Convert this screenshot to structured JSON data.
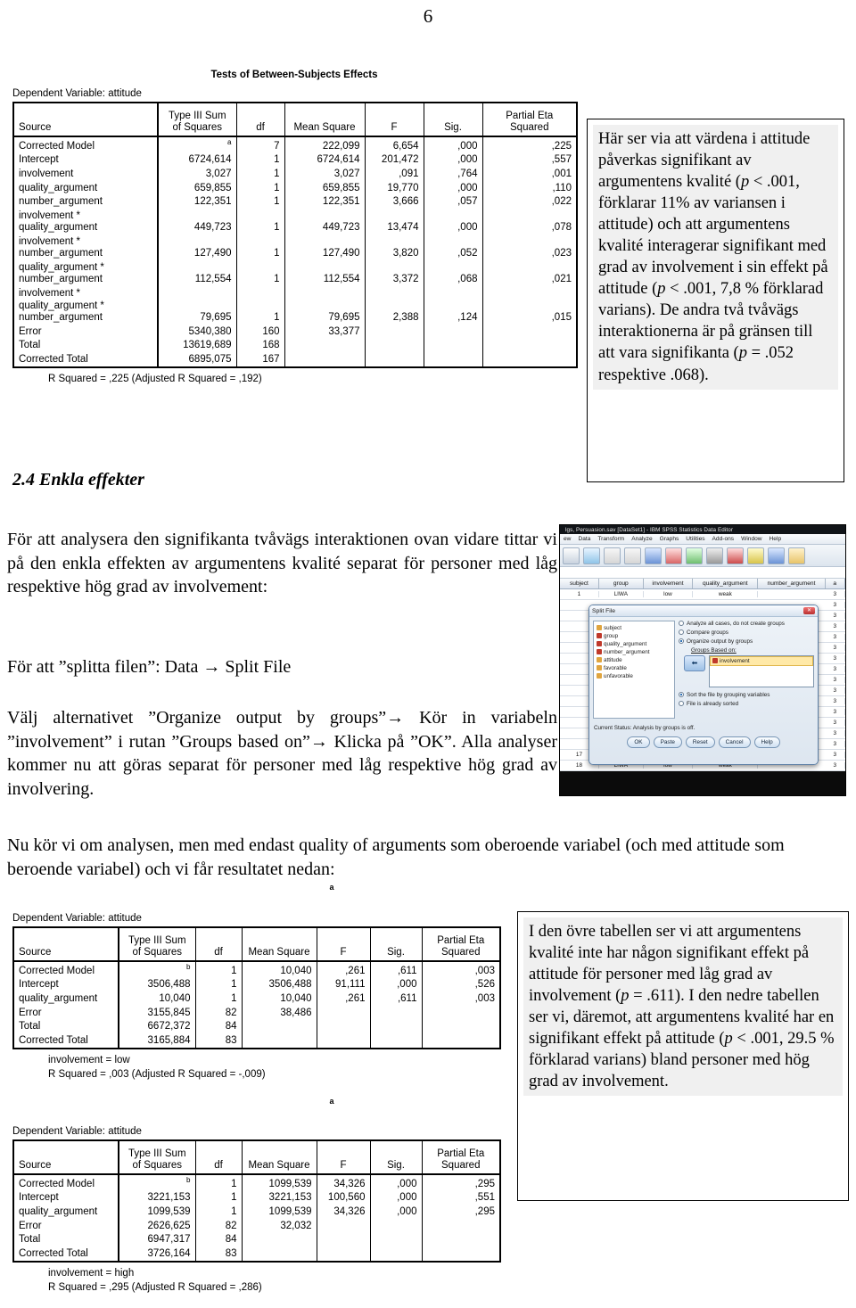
{
  "page": {
    "number": "6"
  },
  "table1": {
    "title": "Tests of Between-Subjects Effects",
    "dependent_variable": "Dependent Variable: attitude",
    "columns": [
      "Source",
      "Type III Sum\nof Squares",
      "df",
      "Mean Square",
      "F",
      "Sig.",
      "Partial Eta\nSquared"
    ],
    "col_source": "Source",
    "col_ss_l1": "Type III Sum",
    "col_ss_l2": "of Squares",
    "col_df": "df",
    "col_ms": "Mean Square",
    "col_f": "F",
    "col_sig": "Sig.",
    "col_eta_l1": "Partial Eta",
    "col_eta_l2": "Squared",
    "rows": [
      {
        "source": "Corrected Model",
        "ss": "",
        "ss_sup": "a",
        "df": "7",
        "ms": "222,099",
        "f": "6,654",
        "sig": ",000",
        "eta": ",225"
      },
      {
        "source": "Intercept",
        "ss": "6724,614",
        "ss_sup": "",
        "df": "1",
        "ms": "6724,614",
        "f": "201,472",
        "sig": ",000",
        "eta": ",557"
      },
      {
        "source": "involvement",
        "ss": "3,027",
        "ss_sup": "",
        "df": "1",
        "ms": "3,027",
        "f": ",091",
        "sig": ",764",
        "eta": ",001"
      },
      {
        "source": "quality_argument",
        "ss": "659,855",
        "ss_sup": "",
        "df": "1",
        "ms": "659,855",
        "f": "19,770",
        "sig": ",000",
        "eta": ",110"
      },
      {
        "source": "number_argument",
        "ss": "122,351",
        "ss_sup": "",
        "df": "1",
        "ms": "122,351",
        "f": "3,666",
        "sig": ",057",
        "eta": ",022"
      },
      {
        "source": "involvement *\nquality_argument",
        "ss": "449,723",
        "ss_sup": "",
        "df": "1",
        "ms": "449,723",
        "f": "13,474",
        "sig": ",000",
        "eta": ",078"
      },
      {
        "source": "involvement *\nnumber_argument",
        "ss": "127,490",
        "ss_sup": "",
        "df": "1",
        "ms": "127,490",
        "f": "3,820",
        "sig": ",052",
        "eta": ",023"
      },
      {
        "source": "quality_argument *\nnumber_argument",
        "ss": "112,554",
        "ss_sup": "",
        "df": "1",
        "ms": "112,554",
        "f": "3,372",
        "sig": ",068",
        "eta": ",021"
      },
      {
        "source": "involvement *\nquality_argument *\nnumber_argument",
        "ss": "79,695",
        "ss_sup": "",
        "df": "1",
        "ms": "79,695",
        "f": "2,388",
        "sig": ",124",
        "eta": ",015"
      },
      {
        "source": "Error",
        "ss": "5340,380",
        "ss_sup": "",
        "df": "160",
        "ms": "33,377",
        "f": "",
        "sig": "",
        "eta": ""
      },
      {
        "source": "Total",
        "ss": "13619,689",
        "ss_sup": "",
        "df": "168",
        "ms": "",
        "f": "",
        "sig": "",
        "eta": ""
      },
      {
        "source": "Corrected Total",
        "ss": "6895,075",
        "ss_sup": "",
        "df": "167",
        "ms": "",
        "f": "",
        "sig": "",
        "eta": ""
      }
    ],
    "footnote": "R Squared = ,225 (Adjusted R Squared = ,192)"
  },
  "callout1": {
    "line1": "Här ser via att värdena i attitude påverkas signifikant av argumentens kvalité (",
    "it1": "p",
    "line2": " < .001, förklarar 11% av variansen i attitude) och att argumentens kvalité interagerar signifikant med grad av involvement i sin effekt på attitude (",
    "it2": "p",
    "line3": " < .001, 7,8 % förklarad varians). De andra två tvåvägs interaktionerna är på gränsen till att vara signifikanta (",
    "it3": "p",
    "line4": " = .052 respektive .068)."
  },
  "section": {
    "heading": "2.4 Enkla effekter",
    "para1": "För att analysera den signifikanta tvåvägs interaktionen ovan vidare tittar vi på den enkla effekten av argumentens kvalité separat för personer med låg respektive hög grad av involvement:",
    "para2": "För att ”splitta filen”: Data → Split File",
    "para3": "Välj alternativet ”Organize output by groups”→ Kör in variabeln ”involvement” i rutan ”Groups based on”→ Klicka på ”OK”. Alla analyser kommer nu att göras separat för personer med låg respektive hög grad av involvering.",
    "para4": "Nu kör vi om analysen, men med endast quality of arguments som oberoende variabel (och med attitude som beroende variabel) och vi får resultatet nedan:"
  },
  "spss_screenshot": {
    "window_title": "lgs, Persuasion.sav [DataSet1] - IBM SPSS Statistics Data Editor",
    "menus": [
      "ew",
      "Data",
      "Transform",
      "Analyze",
      "Graphs",
      "Utilities",
      "Add-ons",
      "Window",
      "Help"
    ],
    "grid_headers": [
      "subject",
      "group",
      "involvement",
      "quality_argument",
      "number_argument",
      "a"
    ],
    "grid_rows": [
      [
        "1",
        "LIWA",
        "low",
        "weak",
        "",
        "3"
      ],
      [
        "",
        "",
        "",
        "",
        "",
        "3"
      ],
      [
        "",
        "",
        "",
        "",
        "",
        "3"
      ],
      [
        "",
        "",
        "",
        "",
        "",
        "3"
      ],
      [
        "",
        "",
        "",
        "",
        "",
        "3"
      ],
      [
        "",
        "",
        "",
        "",
        "",
        "3"
      ],
      [
        "",
        "",
        "",
        "",
        "",
        "3"
      ],
      [
        "",
        "",
        "",
        "",
        "",
        "3"
      ],
      [
        "",
        "",
        "",
        "",
        "",
        "3"
      ],
      [
        "",
        "",
        "",
        "",
        "",
        "3"
      ],
      [
        "",
        "",
        "",
        "",
        "",
        "3"
      ],
      [
        "",
        "",
        "",
        "",
        "",
        "3"
      ],
      [
        "",
        "",
        "",
        "",
        "",
        "3"
      ],
      [
        "",
        "",
        "",
        "",
        "",
        "3"
      ],
      [
        "",
        "",
        "",
        "",
        "",
        "3"
      ],
      [
        "17",
        "LIWA",
        "low",
        "weak",
        "",
        "3"
      ],
      [
        "18",
        "LIWA",
        "low",
        "weak",
        "",
        "3"
      ]
    ],
    "dialog": {
      "title": "Split File",
      "close_label": "✕",
      "variables": [
        "subject",
        "group",
        "quality_argument",
        "number_argument",
        "attitude",
        "favorable",
        "unfavorable"
      ],
      "option1": "Analyze all cases, do not create groups",
      "option2": "Compare groups",
      "option3": "Organize output by groups",
      "groups_label": "Groups Based on:",
      "selected_variable": "involvement",
      "sort_option": "Sort the file by grouping variables",
      "sorted_option": "File is already sorted",
      "status": "Current Status: Analysis by groups is off.",
      "buttons": [
        "OK",
        "Paste",
        "Reset",
        "Cancel",
        "Help"
      ],
      "arrow_glyph": "⬅"
    }
  },
  "table2": {
    "marker": "a",
    "dependent_variable": "Dependent Variable: attitude",
    "col_source": "Source",
    "col_ss_l1": "Type III Sum",
    "col_ss_l2": "of Squares",
    "col_df": "df",
    "col_ms": "Mean Square",
    "col_f": "F",
    "col_sig": "Sig.",
    "col_eta_l1": "Partial Eta",
    "col_eta_l2": "Squared",
    "rows": [
      {
        "source": "Corrected Model",
        "ss": "",
        "ss_sup": "b",
        "df": "1",
        "ms": "10,040",
        "f": ",261",
        "sig": ",611",
        "eta": ",003"
      },
      {
        "source": "Intercept",
        "ss": "3506,488",
        "ss_sup": "",
        "df": "1",
        "ms": "3506,488",
        "f": "91,111",
        "sig": ",000",
        "eta": ",526"
      },
      {
        "source": "quality_argument",
        "ss": "10,040",
        "ss_sup": "",
        "df": "1",
        "ms": "10,040",
        "f": ",261",
        "sig": ",611",
        "eta": ",003"
      },
      {
        "source": "Error",
        "ss": "3155,845",
        "ss_sup": "",
        "df": "82",
        "ms": "38,486",
        "f": "",
        "sig": "",
        "eta": ""
      },
      {
        "source": "Total",
        "ss": "6672,372",
        "ss_sup": "",
        "df": "84",
        "ms": "",
        "f": "",
        "sig": "",
        "eta": ""
      },
      {
        "source": "Corrected Total",
        "ss": "3165,884",
        "ss_sup": "",
        "df": "83",
        "ms": "",
        "f": "",
        "sig": "",
        "eta": ""
      }
    ],
    "footnote1": "involvement = low",
    "footnote2": "R Squared = ,003 (Adjusted R Squared = -,009)"
  },
  "table3": {
    "marker": "a",
    "dependent_variable": "Dependent Variable: attitude",
    "col_source": "Source",
    "col_ss_l1": "Type III Sum",
    "col_ss_l2": "of Squares",
    "col_df": "df",
    "col_ms": "Mean Square",
    "col_f": "F",
    "col_sig": "Sig.",
    "col_eta_l1": "Partial Eta",
    "col_eta_l2": "Squared",
    "rows": [
      {
        "source": "Corrected Model",
        "ss": "",
        "ss_sup": "b",
        "df": "1",
        "ms": "1099,539",
        "f": "34,326",
        "sig": ",000",
        "eta": ",295"
      },
      {
        "source": "Intercept",
        "ss": "3221,153",
        "ss_sup": "",
        "df": "1",
        "ms": "3221,153",
        "f": "100,560",
        "sig": ",000",
        "eta": ",551"
      },
      {
        "source": "quality_argument",
        "ss": "1099,539",
        "ss_sup": "",
        "df": "1",
        "ms": "1099,539",
        "f": "34,326",
        "sig": ",000",
        "eta": ",295"
      },
      {
        "source": "Error",
        "ss": "2626,625",
        "ss_sup": "",
        "df": "82",
        "ms": "32,032",
        "f": "",
        "sig": "",
        "eta": ""
      },
      {
        "source": "Total",
        "ss": "6947,317",
        "ss_sup": "",
        "df": "84",
        "ms": "",
        "f": "",
        "sig": "",
        "eta": ""
      },
      {
        "source": "Corrected Total",
        "ss": "3726,164",
        "ss_sup": "",
        "df": "83",
        "ms": "",
        "f": "",
        "sig": "",
        "eta": ""
      }
    ],
    "footnote1": "involvement = high",
    "footnote2": "R Squared = ,295 (Adjusted R Squared = ,286)"
  },
  "callout2": {
    "t1": "I den övre tabellen ser vi att argumentens kvalité inte har någon signifikant effekt på attitude för personer med låg grad av involvement (",
    "it1": "p",
    "t2": " = .611). I den nedre tabellen ser vi, däremot, att argumentens kvalité har en signifikant effekt på attitude (",
    "it2": "p",
    "t3": " < .001, 29.5 % förklarad varians) bland personer med hög grad av involvement."
  }
}
